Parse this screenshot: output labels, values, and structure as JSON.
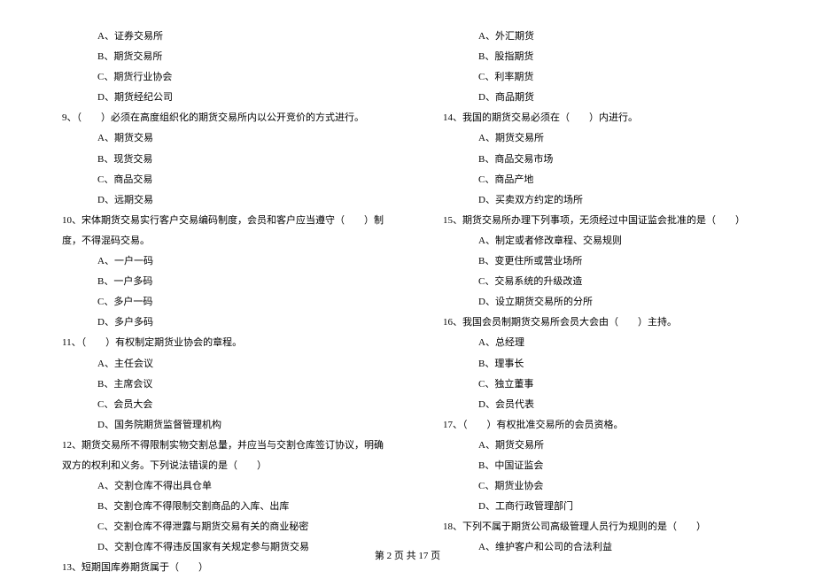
{
  "left": {
    "opts1": [
      "A、证券交易所",
      "B、期货交易所",
      "C、期货行业协会",
      "D、期货经纪公司"
    ],
    "q9": "9、（　　）必须在高度组织化的期货交易所内以公开竞价的方式进行。",
    "opts9": [
      "A、期货交易",
      "B、现货交易",
      "C、商品交易",
      "D、远期交易"
    ],
    "q10": "10、宋体期货交易实行客户交易编码制度，会员和客户应当遵守（　　）制度，不得混码交易。",
    "opts10": [
      "A、一户一码",
      "B、一户多码",
      "C、多户一码",
      "D、多户多码"
    ],
    "q11": "11、（　　）有权制定期货业协会的章程。",
    "opts11": [
      "A、主任会议",
      "B、主席会议",
      "C、会员大会",
      "D、国务院期货监督管理机构"
    ],
    "q12": "12、期货交易所不得限制实物交割总量，并应当与交割仓库签订协议，明确双方的权利和义务。下列说法错误的是（　　）",
    "opts12": [
      "A、交割仓库不得出具仓单",
      "B、交割仓库不得限制交割商品的入库、出库",
      "C、交割仓库不得泄露与期货交易有关的商业秘密",
      "D、交割仓库不得违反国家有关规定参与期货交易"
    ],
    "q13": "13、短期国库券期货属于（　　）"
  },
  "right": {
    "opts13": [
      "A、外汇期货",
      "B、股指期货",
      "C、利率期货",
      "D、商品期货"
    ],
    "q14": "14、我国的期货交易必须在（　　）内进行。",
    "opts14": [
      "A、期货交易所",
      "B、商品交易市场",
      "C、商品产地",
      "D、买卖双方约定的场所"
    ],
    "q15": "15、期货交易所办理下列事项，无须经过中国证监会批准的是（　　）",
    "opts15": [
      "A、制定或者修改章程、交易规则",
      "B、变更住所或营业场所",
      "C、交易系统的升级改造",
      "D、设立期货交易所的分所"
    ],
    "q16": "16、我国会员制期货交易所会员大会由（　　）主持。",
    "opts16": [
      "A、总经理",
      "B、理事长",
      "C、独立董事",
      "D、会员代表"
    ],
    "q17": "17、（　　）有权批准交易所的会员资格。",
    "opts17": [
      "A、期货交易所",
      "B、中国证监会",
      "C、期货业协会",
      "D、工商行政管理部门"
    ],
    "q18": "18、下列不属于期货公司高级管理人员行为规则的是（　　）",
    "opts18": [
      "A、维护客户和公司的合法利益"
    ]
  },
  "footer": "第 2 页 共 17 页"
}
